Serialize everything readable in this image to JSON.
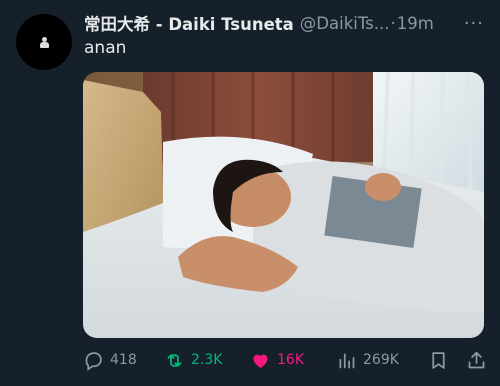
{
  "tweet": {
    "author_name": "常田大希 - Daiki Tsuneta",
    "handle": "@DaikiTs...",
    "separator": "·",
    "time": "19m",
    "more": "···",
    "text": "anan"
  },
  "media": {
    "icon": "photo"
  },
  "actions": {
    "replies": "418",
    "reposts": "2.3K",
    "likes": "16K",
    "views": "269K",
    "repost_color": "#00ba7c",
    "like_color": "#f91880",
    "muted_color": "#8b98a5"
  },
  "theme": {
    "background": "#15202b",
    "text": "#e7e9ea"
  }
}
